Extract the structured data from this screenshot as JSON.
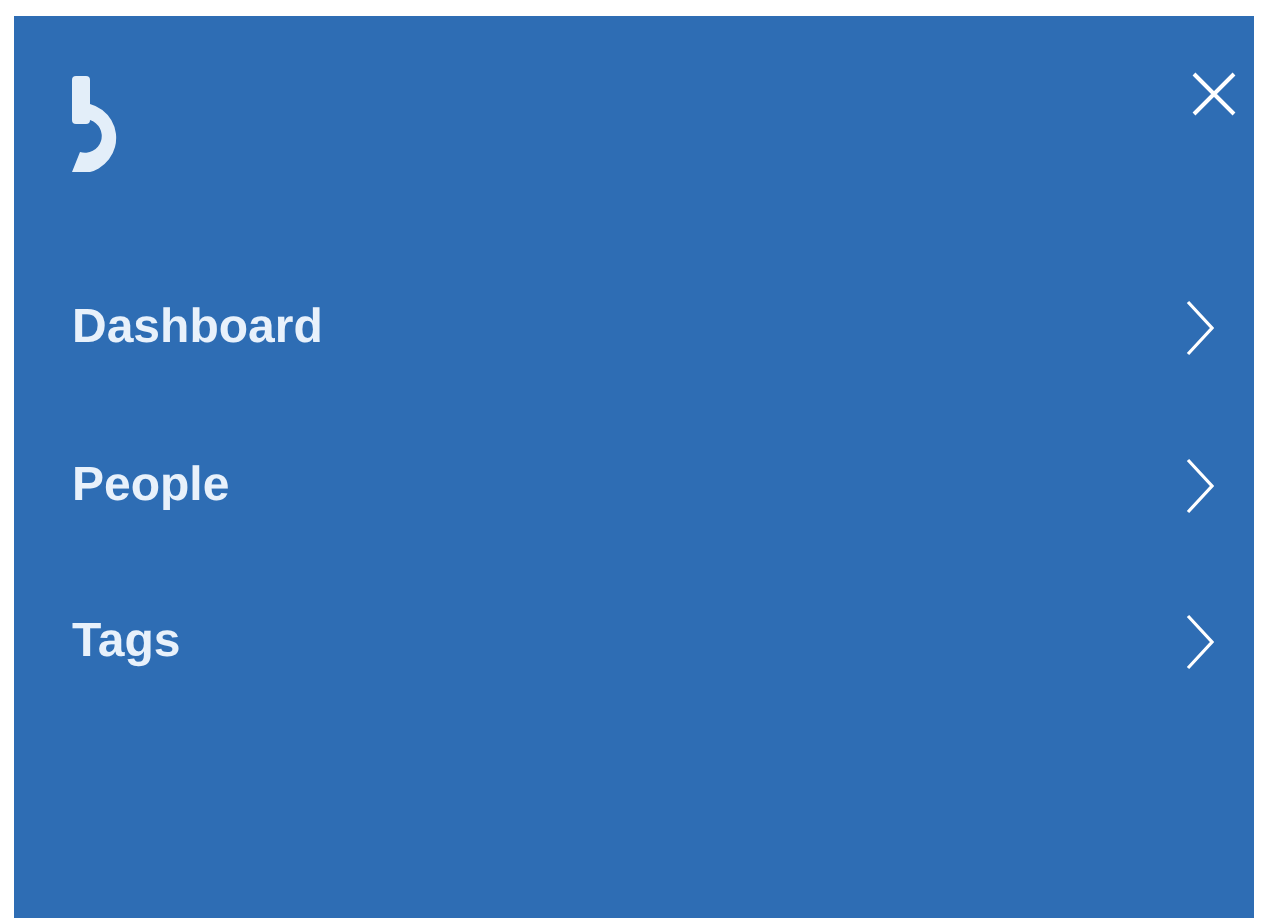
{
  "menu": {
    "items": [
      {
        "label": "Dashboard"
      },
      {
        "label": "People"
      },
      {
        "label": "Tags"
      }
    ]
  }
}
